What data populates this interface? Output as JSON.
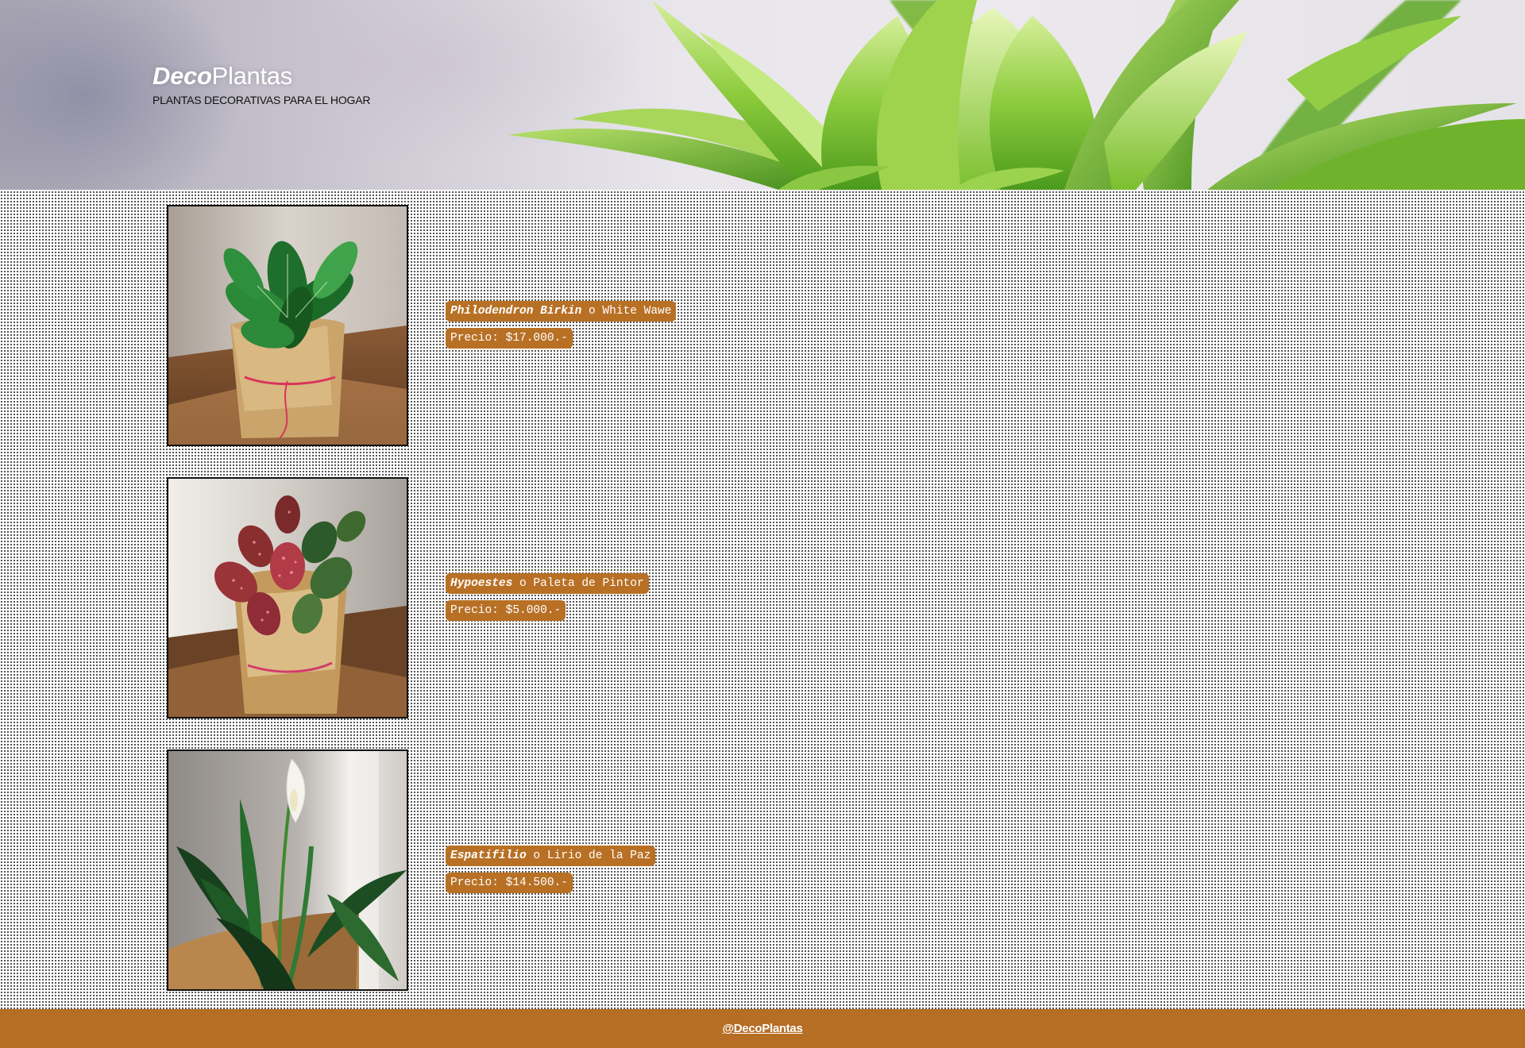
{
  "header": {
    "brand_prefix": "Deco",
    "brand_suffix": "Plantas",
    "tagline": "PLANTAS DECORATIVAS PARA EL HOGAR"
  },
  "products": [
    {
      "scientific_name": "Philodendron Birkin",
      "common_name": " o White Wawe",
      "price": "Precio: $17.000.-"
    },
    {
      "scientific_name": "Hypoestes",
      "common_name": " o Paleta de Pintor",
      "price": "Precio: $5.000.-"
    },
    {
      "scientific_name": "Espatifilio",
      "common_name": " o Lirio de la Paz",
      "price": "Precio: $14.500.-"
    }
  ],
  "footer": {
    "handle": "@DecoPlantas"
  },
  "colors": {
    "accent": "#b87025",
    "footer_bg": "#b66d24",
    "text_dark": "#111111"
  }
}
